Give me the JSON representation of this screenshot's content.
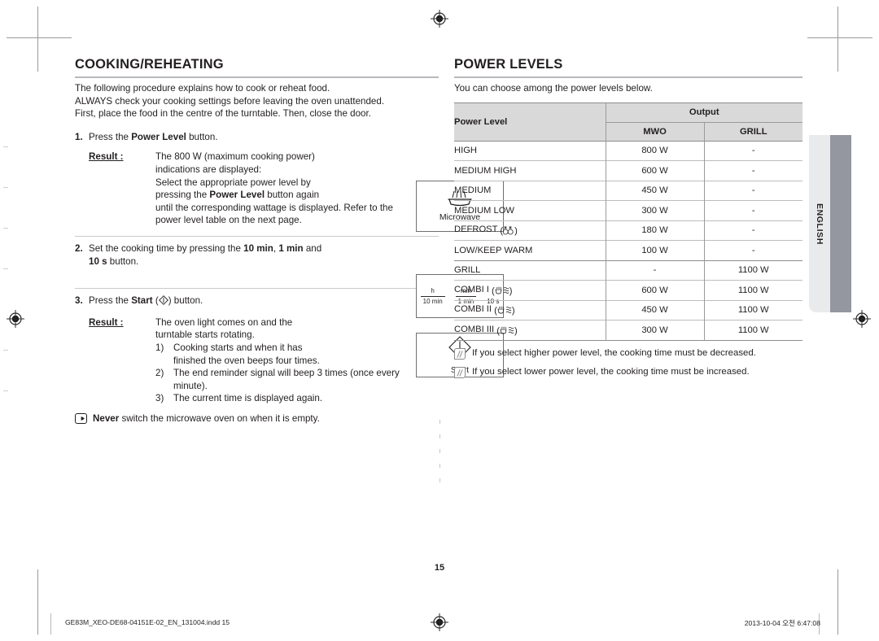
{
  "left": {
    "section_title": "COOKING/REHEATING",
    "lead_lines": [
      "The following procedure explains how to cook or reheat food.",
      "ALWAYS check your cooking settings before leaving the oven unattended.",
      "First, place the food in the centre of the turntable. Then, close the door."
    ],
    "step1": {
      "num": "1.",
      "text_before": "Press the ",
      "text_bold": "Power Level",
      "text_after": " button.",
      "result_label": "Result :",
      "result_lines_1": "The 800 W (maximum cooking power)",
      "result_lines_2": "indications are displayed:",
      "result_lines_3": "Select the appropriate power level by",
      "result_lines_4a": "pressing the ",
      "result_lines_4b": "Power Level",
      "result_lines_4c": " button again",
      "result_lines_5": "until the corresponding wattage is displayed. Refer to the",
      "result_lines_6": "power level table on the next page."
    },
    "step2": {
      "num": "2.",
      "t1": "Set the cooking time by pressing the ",
      "b1": "10 min",
      "t2": ", ",
      "b2": "1 min",
      "t3": " and",
      "b3": "10 s",
      "t4": " button."
    },
    "step3": {
      "num": "3.",
      "t1": "Press the ",
      "b1": "Start",
      "t2": " (",
      "t3": ") button.",
      "result_label": "Result :",
      "result_line_1": "The oven light comes on and the",
      "result_line_2": "turntable starts rotating.",
      "sub": [
        {
          "marker": "1)",
          "text": "Cooking starts and when it has"
        },
        {
          "marker": "",
          "text": "finished the oven beeps four times."
        },
        {
          "marker": "2)",
          "text": "The end reminder signal will beep 3 times (once every"
        },
        {
          "marker": "",
          "text": "minute)."
        },
        {
          "marker": "3)",
          "text": "The current time is displayed again."
        }
      ]
    },
    "never_note": {
      "bold": "Never",
      "text": " switch the microwave oven on when it is empty."
    },
    "keys": {
      "microwave_label": "Microwave",
      "start_label": "Start",
      "time_h": "h",
      "time_10min": "10 min",
      "time_min": "min",
      "time_1min": "1 min",
      "time_10s": "10 s"
    }
  },
  "right": {
    "section_title": "POWER LEVELS",
    "lead": "You can choose among the power levels below.",
    "table": {
      "col_power_level": "Power Level",
      "col_output": "Output",
      "col_mwo": "MWO",
      "col_grill": "GRILL",
      "rows": [
        {
          "level": "HIGH",
          "sym": "",
          "mwo": "800 W",
          "grill": "-",
          "group_top": true
        },
        {
          "level": "MEDIUM HIGH",
          "sym": "",
          "mwo": "600 W",
          "grill": "-",
          "group_top": false
        },
        {
          "level": "MEDIUM",
          "sym": "",
          "mwo": "450 W",
          "grill": "-",
          "group_top": false
        },
        {
          "level": "MEDIUM LOW",
          "sym": "",
          "mwo": "300 W",
          "grill": "-",
          "group_top": false
        },
        {
          "level": "DEFROST",
          "sym": "defrost",
          "mwo": "180 W",
          "grill": "-",
          "group_top": false
        },
        {
          "level": "LOW/KEEP WARM",
          "sym": "",
          "mwo": "100 W",
          "grill": "-",
          "group_top": false
        },
        {
          "level": "GRILL",
          "sym": "",
          "mwo": "-",
          "grill": "1100 W",
          "group_top": true
        },
        {
          "level": "COMBI I",
          "sym": "combi",
          "mwo": "600 W",
          "grill": "1100 W",
          "group_top": false
        },
        {
          "level": "COMBI II",
          "sym": "combi",
          "mwo": "450 W",
          "grill": "1100 W",
          "group_top": false
        },
        {
          "level": "COMBI III",
          "sym": "combi",
          "mwo": "300 W",
          "grill": "1100 W",
          "group_top": false
        }
      ]
    },
    "notes": [
      "If you select higher power level, the cooking time must be decreased.",
      "If you select lower power level, the cooking time must be increased."
    ]
  },
  "side_tab": {
    "label": "ENGLISH"
  },
  "footer": {
    "page_number": "15",
    "file_name": "GE83M_XEO-DE68-04151E-02_EN_131004.indd   15",
    "timestamp": "2013-10-04   오전 6:47:08"
  }
}
